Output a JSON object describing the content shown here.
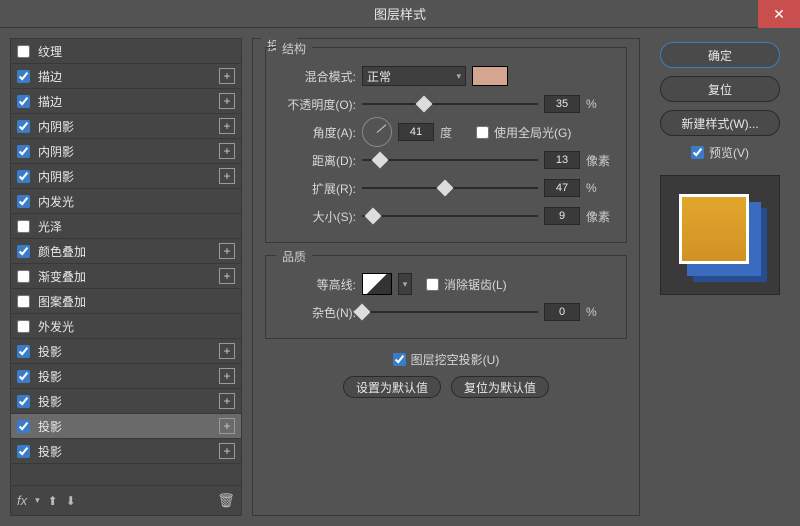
{
  "window": {
    "title": "图层样式"
  },
  "sidebar": {
    "items": [
      {
        "label": "纹理",
        "checked": false,
        "hasAdd": false
      },
      {
        "label": "描边",
        "checked": true,
        "hasAdd": true
      },
      {
        "label": "描边",
        "checked": true,
        "hasAdd": true
      },
      {
        "label": "内阴影",
        "checked": true,
        "hasAdd": true
      },
      {
        "label": "内阴影",
        "checked": true,
        "hasAdd": true
      },
      {
        "label": "内阴影",
        "checked": true,
        "hasAdd": true
      },
      {
        "label": "内发光",
        "checked": true,
        "hasAdd": false
      },
      {
        "label": "光泽",
        "checked": false,
        "hasAdd": false
      },
      {
        "label": "颜色叠加",
        "checked": true,
        "hasAdd": true
      },
      {
        "label": "渐变叠加",
        "checked": false,
        "hasAdd": true
      },
      {
        "label": "图案叠加",
        "checked": false,
        "hasAdd": false
      },
      {
        "label": "外发光",
        "checked": false,
        "hasAdd": false
      },
      {
        "label": "投影",
        "checked": true,
        "hasAdd": true
      },
      {
        "label": "投影",
        "checked": true,
        "hasAdd": true
      },
      {
        "label": "投影",
        "checked": true,
        "hasAdd": true
      },
      {
        "label": "投影",
        "checked": true,
        "hasAdd": true,
        "selected": true
      },
      {
        "label": "投影",
        "checked": true,
        "hasAdd": true
      }
    ],
    "fx_label": "fx"
  },
  "panel": {
    "title": "投影",
    "structure": {
      "title": "结构",
      "blend_label": "混合模式:",
      "blend_value": "正常",
      "color": "#d4a590",
      "opacity_label": "不透明度(O):",
      "opacity_value": "35",
      "opacity_unit": "%",
      "angle_label": "角度(A):",
      "angle_value": "41",
      "angle_unit": "度",
      "global_light_label": "使用全局光(G)",
      "global_light_checked": false,
      "distance_label": "距离(D):",
      "distance_value": "13",
      "distance_unit": "像素",
      "spread_label": "扩展(R):",
      "spread_value": "47",
      "spread_unit": "%",
      "size_label": "大小(S):",
      "size_value": "9",
      "size_unit": "像素"
    },
    "quality": {
      "title": "品质",
      "contour_label": "等高线:",
      "antialias_label": "消除锯齿(L)",
      "antialias_checked": false,
      "noise_label": "杂色(N):",
      "noise_value": "0",
      "noise_unit": "%"
    },
    "knockout_label": "图层挖空投影(U)",
    "knockout_checked": true,
    "default_btn": "设置为默认值",
    "reset_btn": "复位为默认值"
  },
  "buttons": {
    "ok": "确定",
    "cancel": "复位",
    "newstyle": "新建样式(W)...",
    "preview_label": "预览(V)",
    "preview_checked": true
  }
}
